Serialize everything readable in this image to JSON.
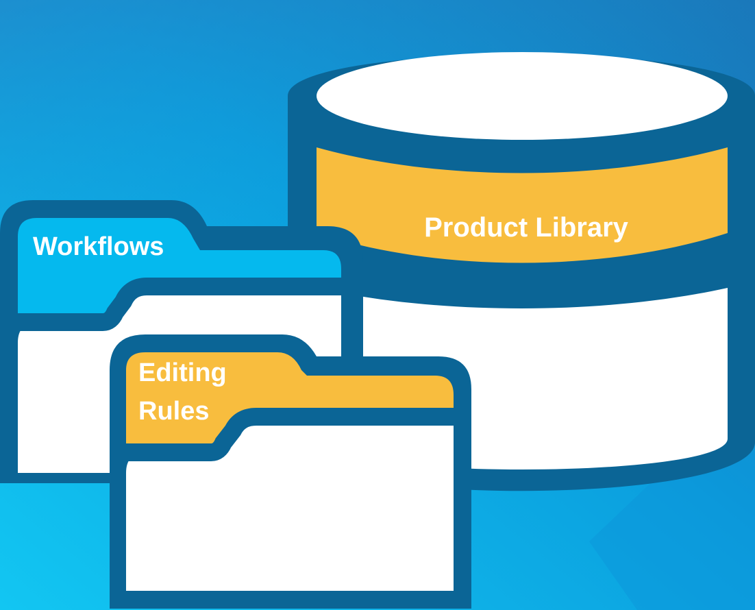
{
  "labels": {
    "database": "Product Library",
    "blue_folder": "Workflows",
    "orange_folder_line1": "Editing",
    "orange_folder_line2": "Rules"
  },
  "colors": {
    "background_light": "#12c2f0",
    "background_mid": "#0aa0de",
    "background_dark": "#1a6fb5",
    "outline": "#0b6596",
    "band": "#f8bd3e",
    "folder_blue": "#05b9ee",
    "white": "#ffffff",
    "text": "#ffffff"
  },
  "icons": [
    "database-icon",
    "folder-icon",
    "folder-icon"
  ]
}
